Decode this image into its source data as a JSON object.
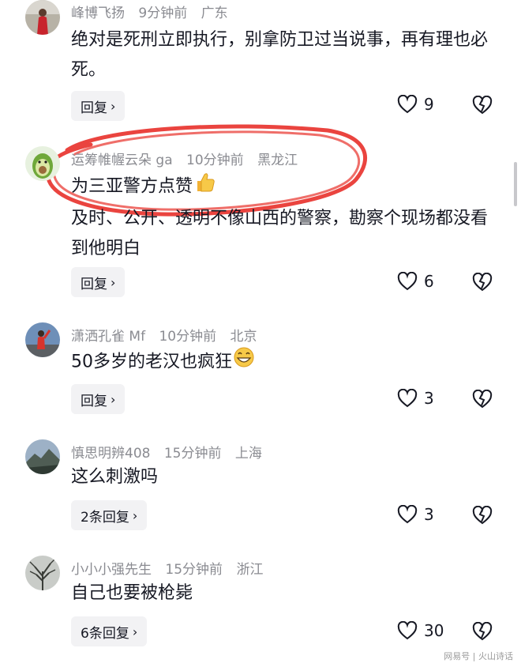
{
  "comments": [
    {
      "username": "峰博飞扬",
      "time": "9分钟前",
      "location": "广东",
      "text": "绝对是死刑立即执行，别拿防卫过当说事，再有理也必死。",
      "reply_label": "回复",
      "like_count": "9",
      "avatar": "person-red-coat-avatar"
    },
    {
      "username": "运筹帷幄云朵 ga",
      "time": "10分钟前",
      "location": "黑龙江",
      "text_line1": "为三亚警方点赞",
      "text_line1_emoji": "thumbs-up-emoji",
      "text_rest": "及时、公开、透明不像山西的警察，勘察个现场都没看到他明白",
      "reply_label": "回复",
      "like_count": "6",
      "avatar": "avocado-avatar",
      "annotation": "red-hand-drawn-circle"
    },
    {
      "username": "潇洒孔雀 Mf",
      "time": "10分钟前",
      "location": "北京",
      "text": "50多岁的老汉也疯狂",
      "text_emoji": "grinning-emoji",
      "reply_label": "回复",
      "like_count": "3",
      "avatar": "hiker-avatar"
    },
    {
      "username": "慎思明辨408",
      "time": "15分钟前",
      "location": "上海",
      "text": "这么刺激吗",
      "reply_label": "2条回复",
      "like_count": "3",
      "avatar": "mountain-avatar"
    },
    {
      "username": "小小小强先生",
      "time": "15分钟前",
      "location": "浙江",
      "text": "自己也要被枪毙",
      "reply_label": "6条回复",
      "like_count": "30",
      "avatar": "tree-avatar"
    }
  ],
  "icons": {
    "like": "heart-outline-icon",
    "dislike": "broken-heart-icon",
    "chevron": "chevron-right-icon"
  },
  "colors": {
    "annotation_red": "#e8302a",
    "meta_gray": "#8a8b91",
    "button_bg": "#f2f2f4"
  },
  "watermark": "网易号 | 火山诗话"
}
